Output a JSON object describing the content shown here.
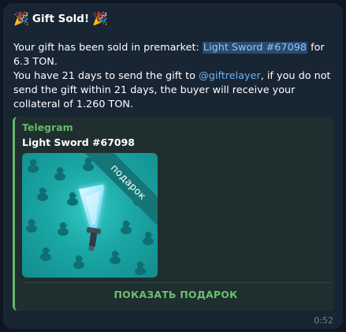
{
  "message": {
    "title": "Gift Sold!",
    "title_emoji_left": "🎉",
    "title_emoji_right": "🎉",
    "line1_prefix": "Your gift has been sold in premarket: ",
    "line1_link": "Light Sword #67098",
    "line1_suffix": " for 6.3 TON.",
    "line2_prefix": "You have 21 days to send the gift to ",
    "line2_mention": "@giftrelayer",
    "line2_suffix": ", if you do not send the gift within 21 days, the buyer will receive your collateral of 1.260 TON.",
    "time": "0:52"
  },
  "preview": {
    "site_name": "Telegram",
    "title": "Light Sword #67098",
    "ribbon_label": "подарок",
    "action_label": "ПОКАЗАТЬ ПОДАРОК",
    "icons": [
      "gift-pattern-icon",
      "light-sword-icon"
    ]
  },
  "colors": {
    "background": "#0e1621",
    "bubble": "#182533",
    "accent_green": "#67b86a",
    "link_blue": "#6ab3f3",
    "card_teal": "#1aa6a5"
  }
}
